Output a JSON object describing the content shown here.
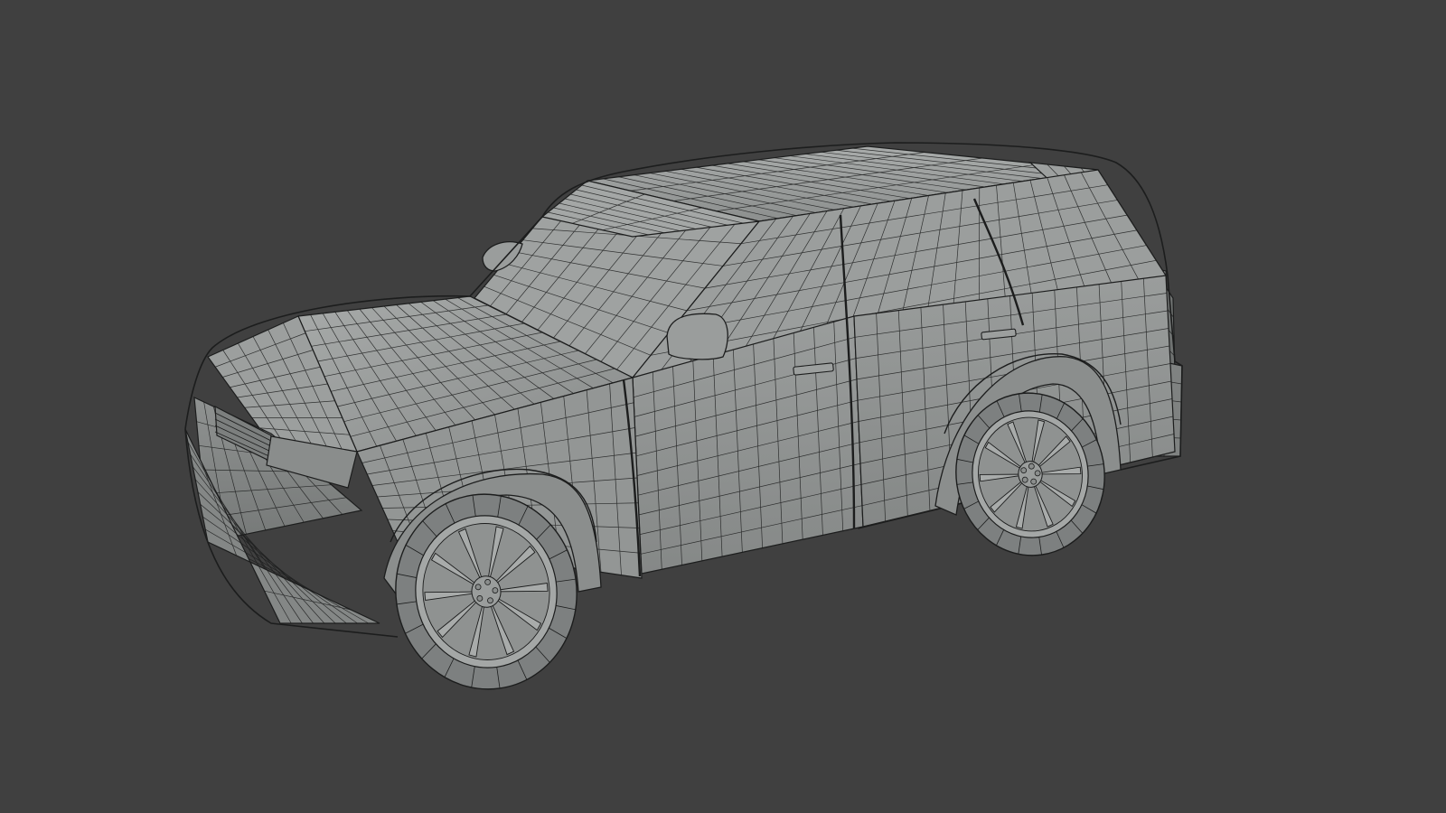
{
  "viewport": {
    "background": "#404040",
    "shading": "solid",
    "overlay": "wireframe"
  },
  "model": {
    "subject": "suv-car",
    "body_color": "#8e9190",
    "shadow_color": "#6f7271",
    "highlight_color": "#b4b7b6",
    "wire_color": "#1c1d1d",
    "tire_color": "#7d8080",
    "rim_color": "#a4a7a6"
  }
}
